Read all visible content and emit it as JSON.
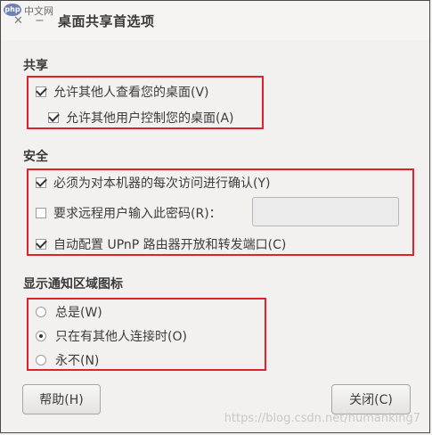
{
  "window": {
    "title": "桌面共享首选项",
    "close_symbol": "✕",
    "minimize_symbol": "−"
  },
  "logo": {
    "badge": "php",
    "text": "中文网"
  },
  "sharing": {
    "title": "共享",
    "allow_view": {
      "label": "允许其他人查看您的桌面(V)",
      "checked": true
    },
    "allow_control": {
      "label": "允许其他用户控制您的桌面(A)",
      "checked": true
    }
  },
  "security": {
    "title": "安全",
    "confirm_each": {
      "label": "必须为对本机器的每次访问进行确认(Y)",
      "checked": true
    },
    "require_password": {
      "label": "要求远程用户输入此密码(R)：",
      "checked": false
    },
    "password_value": "",
    "upnp": {
      "label": "自动配置 UPnP 路由器开放和转发端口(C)",
      "checked": true
    }
  },
  "notification": {
    "title": "显示通知区域图标",
    "options": [
      {
        "label": "总是(W)",
        "selected": false
      },
      {
        "label": "只在有其他人连接时(O)",
        "selected": true
      },
      {
        "label": "永不(N)",
        "selected": false
      }
    ]
  },
  "buttons": {
    "help": "帮助(H)",
    "close": "关闭(C)"
  },
  "watermark": "https://blog.csdn.net/humanking7",
  "colors": {
    "highlight_box": "#e0222a",
    "background": "#f2f1f0"
  }
}
